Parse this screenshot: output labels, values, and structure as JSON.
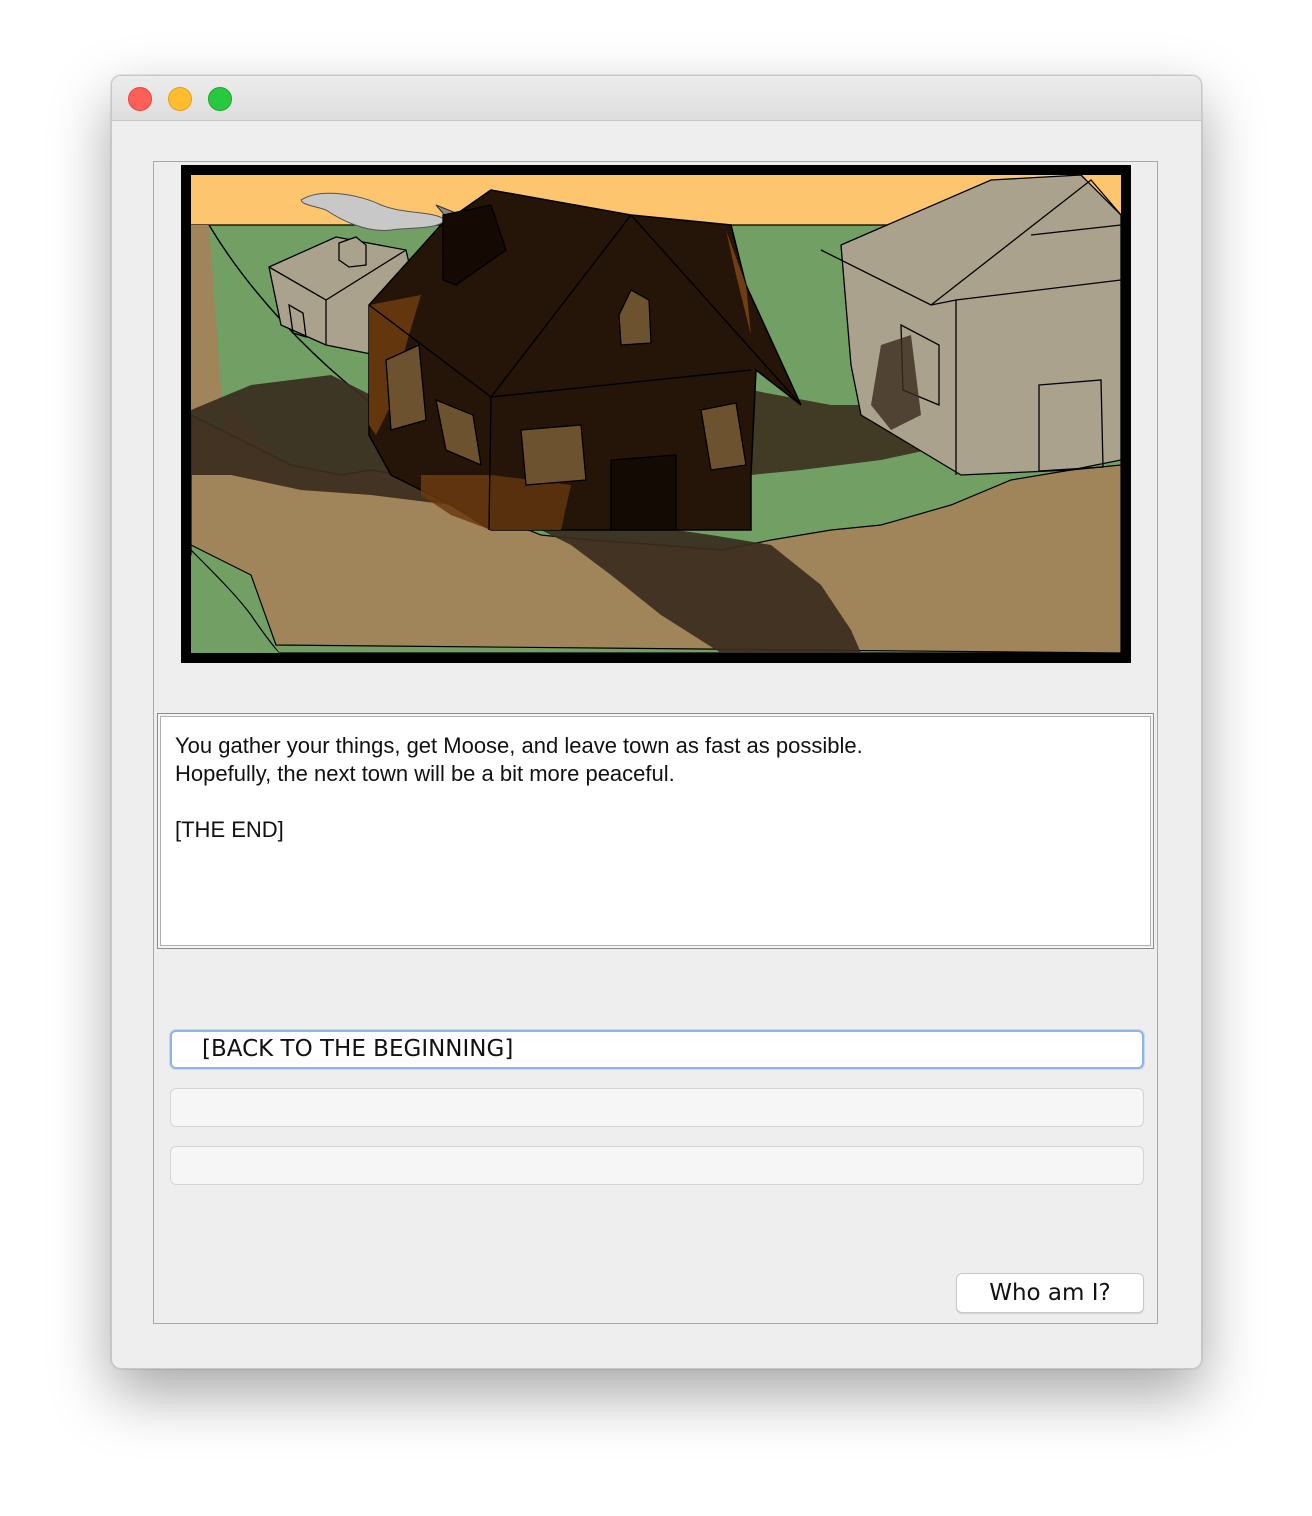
{
  "window": {
    "buttons": [
      "close",
      "minimize",
      "zoom"
    ]
  },
  "scene": {
    "icon": "village-house-scene",
    "colors": {
      "sky": "#fdc56e",
      "grass": "#72a064",
      "dirt": "#a0845a",
      "house": "#251408",
      "shed": "#aba28e",
      "shadow": "#3a2c1e"
    }
  },
  "story": {
    "lines": [
      "You gather your things, get Moose, and leave town as fast as possible.",
      "Hopefully, the next town will be a bit more peaceful.",
      "",
      "[THE END]"
    ]
  },
  "choices": [
    {
      "label": "[BACK TO THE BEGINNING]"
    },
    {
      "label": ""
    },
    {
      "label": ""
    }
  ],
  "who_button": {
    "label": "Who am I?"
  }
}
